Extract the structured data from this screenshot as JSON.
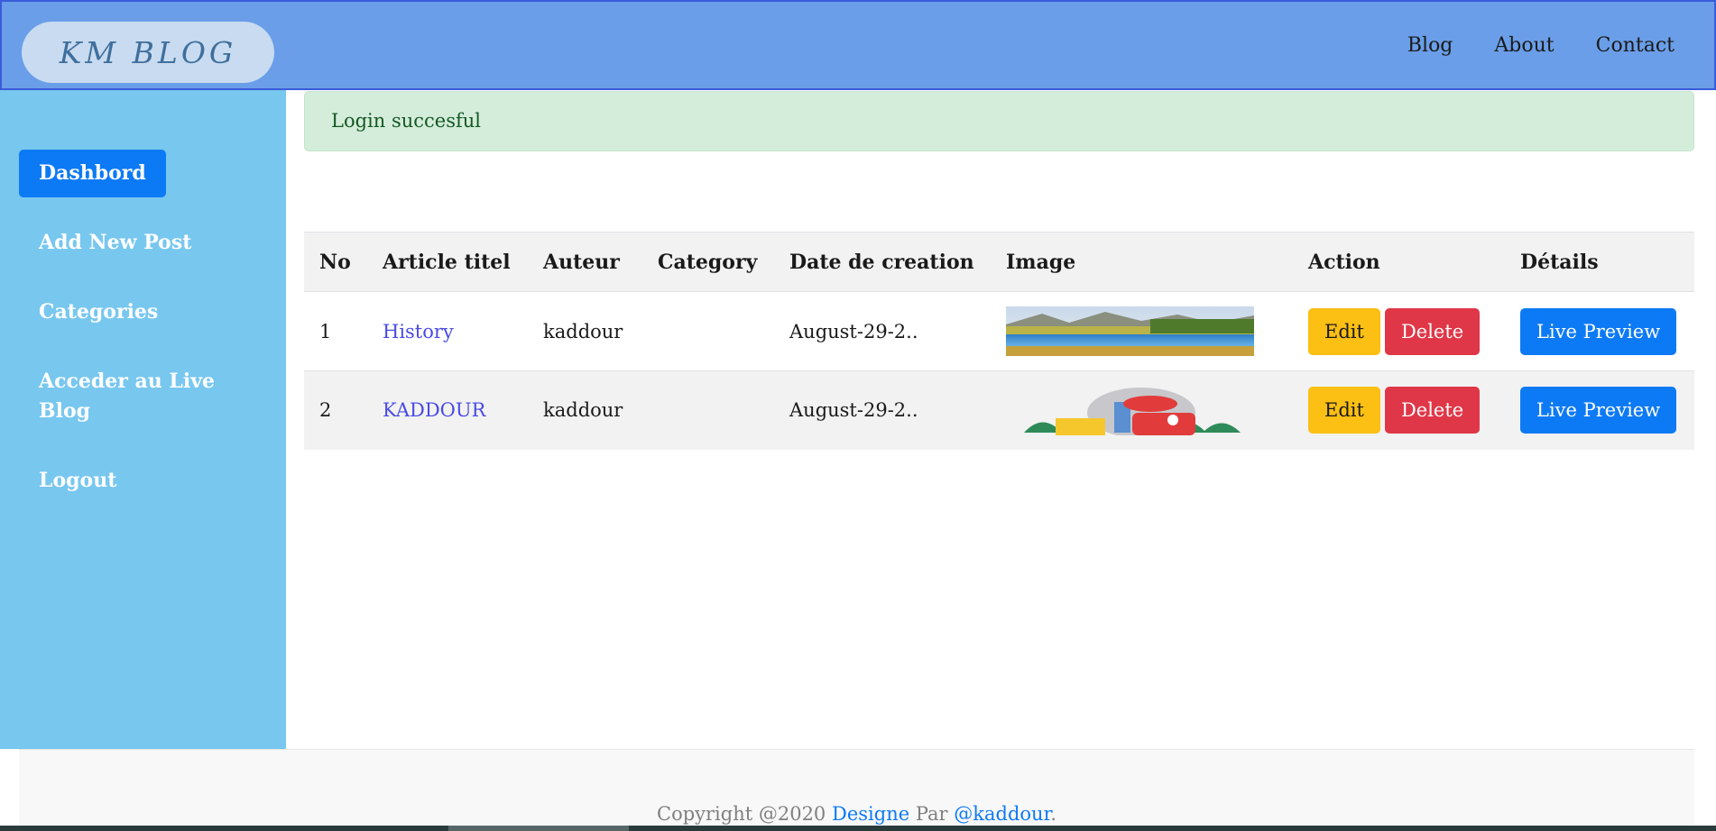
{
  "navbar": {
    "brand": "KM BLOG",
    "links": [
      "Blog",
      "About",
      "Contact"
    ]
  },
  "sidebar": {
    "items": [
      {
        "label": "Dashbord",
        "active": true
      },
      {
        "label": "Add New Post"
      },
      {
        "label": "Categories"
      },
      {
        "label": "Acceder au Live Blog"
      },
      {
        "label": "Logout"
      }
    ]
  },
  "alert": {
    "message": "Login succesful"
  },
  "table": {
    "headers": [
      "No",
      "Article titel",
      "Auteur",
      "Category",
      "Date de creation",
      "Image",
      "Action",
      "Détails"
    ],
    "rows": [
      {
        "no": "1",
        "title": "History",
        "author": "kaddour",
        "category": "",
        "date": "August-29-2..",
        "image": "landscape-thumbnail"
      },
      {
        "no": "2",
        "title": "KADDOUR",
        "author": "kaddour",
        "category": "",
        "date": "August-29-2..",
        "image": "contact-illustration-thumbnail"
      }
    ],
    "actions": {
      "edit": "Edit",
      "delete": "Delete",
      "preview": "Live Preview"
    }
  },
  "footer": {
    "copyright": "Copyright @2020",
    "link1": "Designe",
    "par": "Par",
    "link2": "@kaddour",
    "end": "."
  },
  "colors": {
    "navbar": "#6a9ee8",
    "sidebar": "#78c7ef",
    "primary": "#0d7af5",
    "warning": "#fcbf14",
    "danger": "#df3747",
    "success_bg": "#d4edda"
  }
}
